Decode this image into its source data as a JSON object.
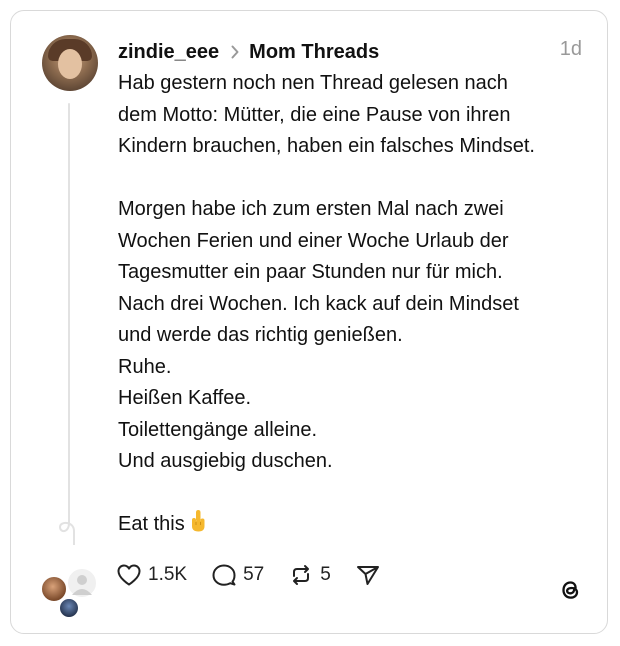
{
  "post": {
    "username": "zindie_eee",
    "community": "Mom Threads",
    "timestamp": "1d",
    "paragraphs": [
      [
        "Hab gestern noch nen Thread gelesen nach",
        "dem Motto: Mütter, die eine Pause von ihren",
        "Kindern brauchen, haben ein falsches Mindset."
      ],
      [
        "Morgen habe ich zum ersten Mal nach zwei",
        "Wochen Ferien und einer Woche Urlaub der",
        "Tagesmutter ein paar Stunden nur für mich.",
        "Nach drei Wochen. Ich kack auf dein Mindset",
        "und werde das richtig genießen.",
        "Ruhe.",
        "Heißen Kaffee.",
        "Toilettengänge alleine.",
        "Und ausgiebig duschen."
      ],
      [
        "Eat this"
      ]
    ],
    "closing_emoji": "middle-finger-emoji"
  },
  "actions": {
    "likes": "1.5K",
    "replies": "57",
    "reposts": "5"
  },
  "icons": {
    "chevron": "chevron-right-icon",
    "like": "heart-icon",
    "reply": "comment-icon",
    "repost": "repost-icon",
    "share": "send-icon",
    "brand": "threads-logo"
  },
  "colors": {
    "text": "#111111",
    "muted": "#999999",
    "border": "#d9d9d9"
  }
}
